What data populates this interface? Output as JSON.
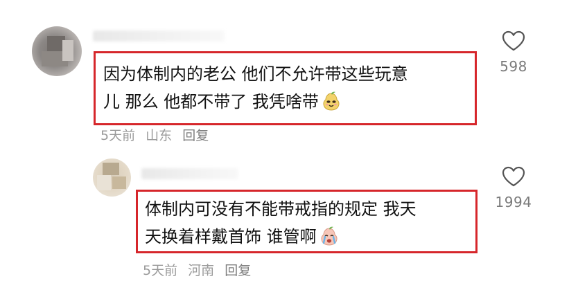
{
  "comments": [
    {
      "text_line_1": "因为体制内的老公 他们不允许带这些玩意",
      "text_line_2": "儿 那么 他都不带了 我凭啥带",
      "emoji": "smug-pear-face-icon",
      "time": "5天前",
      "location": "山东",
      "reply_label": "回复",
      "likes": "598"
    },
    {
      "text_line_1": "体制内可没有不能带戒指的规定 我天",
      "text_line_2": "天换着样戴首饰 谁管啊",
      "emoji": "crying-pear-face-icon",
      "time": "5天前",
      "location": "河南",
      "reply_label": "回复",
      "likes": "1994"
    }
  ],
  "colors": {
    "highlight_border": "#d6262b",
    "meta_text": "#9a9a9a",
    "like_count": "#7a7a7a"
  }
}
